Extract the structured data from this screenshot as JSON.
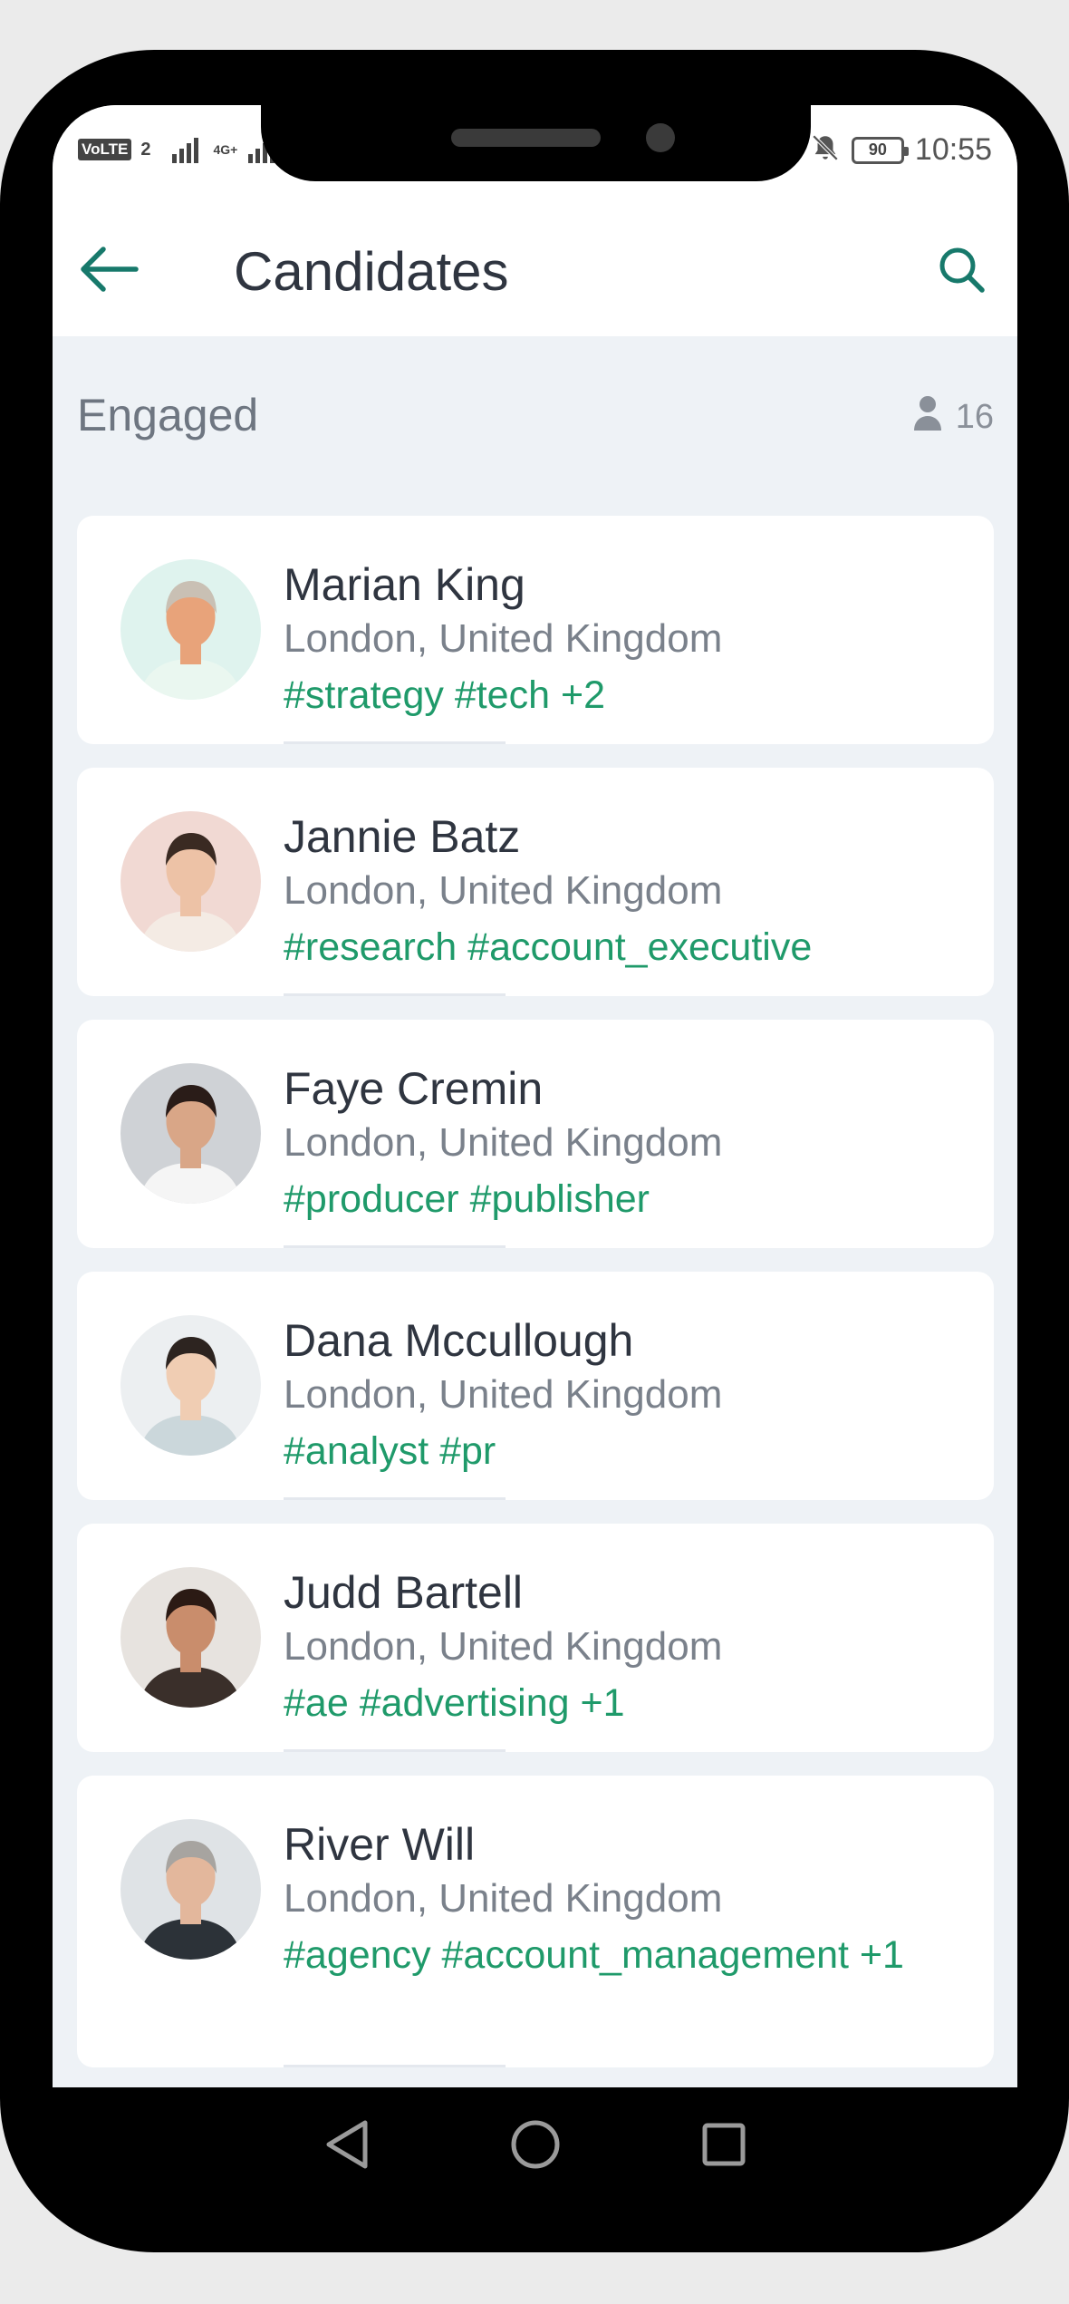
{
  "status_bar": {
    "volte": "VoLTE",
    "sim": "2",
    "network": "4G+",
    "battery": "90",
    "time": "10:55"
  },
  "app_bar": {
    "title": "Candidates",
    "back_icon": "arrow-left-icon",
    "search_icon": "search-icon"
  },
  "section": {
    "title": "Engaged",
    "count": "16",
    "count_icon": "person-icon"
  },
  "candidates": [
    {
      "name": "Marian King",
      "location": "London, United Kingdom",
      "tags": "#strategy #tech +2",
      "avatar_bg": "#dff3ee",
      "skin": "#e8a37a",
      "hair": "#c9c0b4",
      "shirt": "#eaf7f0"
    },
    {
      "name": "Jannie Batz",
      "location": "London, United Kingdom",
      "tags": "#research #account_executive",
      "avatar_bg": "#f1d9d3",
      "skin": "#edc2a6",
      "hair": "#3a2a22",
      "shirt": "#f4ebe4"
    },
    {
      "name": "Faye Cremin",
      "location": "London, United Kingdom",
      "tags": "#producer #publisher",
      "avatar_bg": "#cfd2d6",
      "skin": "#d9a687",
      "hair": "#2a1c18",
      "shirt": "#f5f5f5"
    },
    {
      "name": "Dana Mccullough",
      "location": "London, United Kingdom",
      "tags": "#analyst #pr",
      "avatar_bg": "#eceff1",
      "skin": "#f0cdb3",
      "hair": "#2d2420",
      "shirt": "#cbd7db"
    },
    {
      "name": "Judd Bartell",
      "location": "London, United Kingdom",
      "tags": "#ae #advertising +1",
      "avatar_bg": "#e7e3df",
      "skin": "#c98d6c",
      "hair": "#2b1a14",
      "shirt": "#3a2f2a"
    },
    {
      "name": "River Will",
      "location": "London, United Kingdom",
      "tags": "#agency #account_management +1",
      "avatar_bg": "#dfe3e6",
      "skin": "#e3b79c",
      "hair": "#a7a4a0",
      "shirt": "#2c3238"
    }
  ],
  "nav_bar": {
    "back_icon": "triangle-back-icon",
    "home_icon": "circle-home-icon",
    "recents_icon": "square-recents-icon"
  }
}
